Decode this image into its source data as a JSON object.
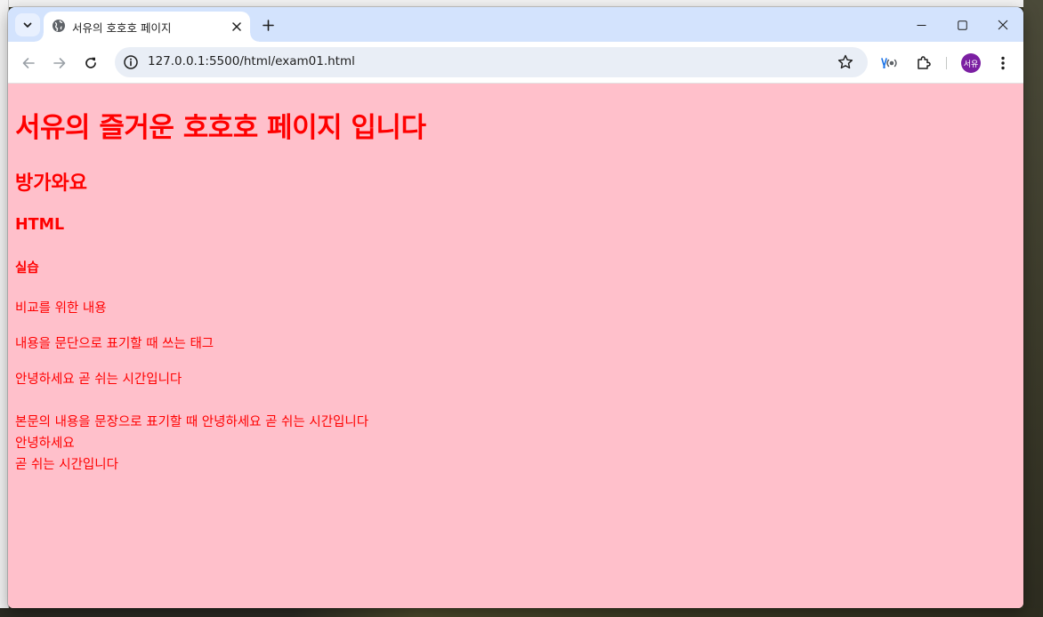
{
  "browser": {
    "tab": {
      "title": "서유의 호호호 페이지",
      "favicon": "globe-icon"
    },
    "address_bar": {
      "url": "127.0.0.1:5500/html/exam01.html"
    },
    "profile": {
      "avatar_text": "서유",
      "color": "#7b1fa2"
    },
    "colors": {
      "tab_strip": "#d3e3fd",
      "omnibox": "#e9eef6"
    }
  },
  "page": {
    "background": "#ffc0cb",
    "text_color": "#ff0000",
    "h1": "서유의 즐거운 호호호 페이지 입니다",
    "h2": "방가와요",
    "h3": "HTML",
    "h4": "실습",
    "p1": "비교를 위한 내용",
    "p2": "내용을 문단으로 표기할 때 쓰는 태그",
    "p3": "안녕하세요 곧 쉬는 시간입니다",
    "p4_line1": "본문의 내용을 문장으로 표기할 때 안녕하세요 곧 쉬는 시간입니다",
    "p4_line2": "안녕하세요",
    "p4_line3": "곧 쉬는 시간입니다"
  }
}
